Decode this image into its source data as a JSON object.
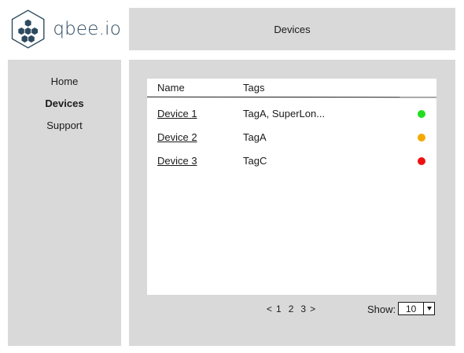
{
  "logo": {
    "text": "qbee.io"
  },
  "header": {
    "title": "Devices"
  },
  "sidebar": {
    "items": [
      {
        "label": "Home",
        "active": false
      },
      {
        "label": "Devices",
        "active": true
      },
      {
        "label": "Support",
        "active": false
      }
    ]
  },
  "table": {
    "columns": {
      "name": "Name",
      "tags": "Tags"
    },
    "rows": [
      {
        "name": "Device 1",
        "tags": "TagA, SuperLon...",
        "status": "online",
        "status_color": "#22dd22"
      },
      {
        "name": "Device 2",
        "tags": "TagA",
        "status": "warning",
        "status_color": "#f2a900"
      },
      {
        "name": "Device 3",
        "tags": "TagC",
        "status": "offline",
        "status_color": "#ee1111"
      }
    ]
  },
  "pagination": {
    "prev": "<",
    "pages": [
      "1",
      "2",
      "3"
    ],
    "next": ">",
    "show_label": "Show:",
    "show_value": "10"
  },
  "colors": {
    "panel": "#d9d9d9",
    "logo": "#2d4a5e"
  }
}
